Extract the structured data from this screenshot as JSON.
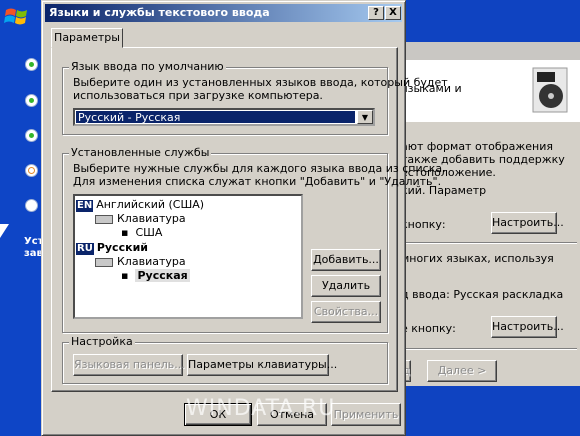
{
  "colors": {
    "desktop_blue": "#0f43c1",
    "title_start": "#0a246a",
    "title_end": "#a6caf0",
    "face": "#d4d0c8"
  },
  "background": {
    "left_text_line1": "Уст",
    "left_text_line2": "зав",
    "right_window": {
      "header_text": "языками и",
      "p1_line1": "ают формат отображения",
      "p1_line2": "также добавить поддержку",
      "p1_line3": "естоположение.",
      "p2": "кий. Параметр",
      "p3": "кнопку:",
      "configure_label_1": "Настроить...",
      "p4": "многих языках, используя",
      "p5": "д ввода: Русская раскладка",
      "p6": "е кнопку:",
      "configure_label_2": "Настроить...",
      "next_label": "Далее >",
      "back_label": "д"
    }
  },
  "dialog": {
    "title": "Языки и службы текстового ввода",
    "help_label": "?",
    "close_label": "X",
    "tab_label": "Параметры",
    "default_lang": {
      "legend": "Язык ввода по умолчанию",
      "desc1": "Выберите один из установленных языков ввода, который будет",
      "desc2": "использоваться при загрузке компьютера.",
      "selected": "Русский - Русская",
      "arrow": "▼"
    },
    "installed": {
      "legend": "Установленные службы",
      "desc1": "Выберите нужные службы для каждого языка ввода из списка.",
      "desc2": "Для изменения списка служат кнопки \"Добавить\" и \"Удалить\".",
      "tree": {
        "en_badge": "EN",
        "en_lang": "Английский (США)",
        "en_kbd": "Клавиатура",
        "en_layout": "США",
        "ru_badge": "RU",
        "ru_lang": "Русский",
        "ru_kbd": "Клавиатура",
        "ru_layout": "Русская",
        "bullet": "▪"
      },
      "add_label": "Добавить...",
      "remove_label": "Удалить",
      "props_label": "Свойства..."
    },
    "settings": {
      "legend": "Настройка",
      "langbar_label": "Языковая панель...",
      "keyboard_label": "Параметры клавиатуры..."
    },
    "ok_label": "ОК",
    "cancel_label": "Отмена",
    "apply_label": "Применить"
  },
  "watermark": "WINDATA.RU"
}
